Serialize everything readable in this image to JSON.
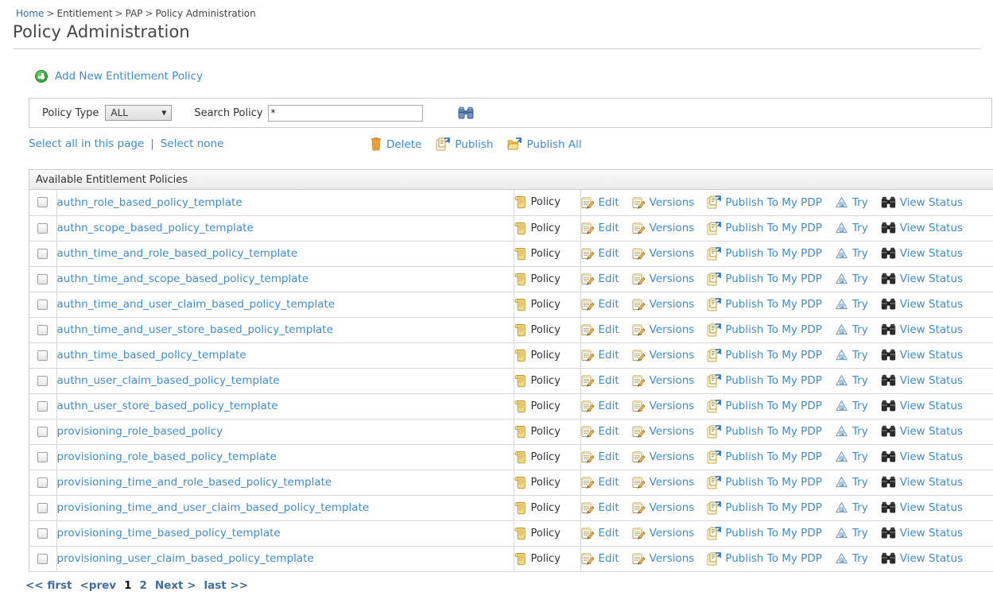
{
  "breadcrumb": {
    "items": [
      {
        "label": "Home",
        "link": true
      },
      {
        "label": "Entitlement",
        "link": false
      },
      {
        "label": "PAP",
        "link": false
      },
      {
        "label": "Policy Administration",
        "link": false
      }
    ],
    "separator": ">"
  },
  "page": {
    "title": "Policy Administration"
  },
  "actions": {
    "add_new_label": "Add New Entitlement Policy",
    "add_new_icon": "plus-circle-icon"
  },
  "filter": {
    "policy_type_label": "Policy Type",
    "policy_type_value": "ALL",
    "policy_type_options": [
      "ALL"
    ],
    "search_label": "Search Policy",
    "search_value": "*",
    "search_placeholder": "",
    "search_icon": "binoculars-icon"
  },
  "selection": {
    "select_all_label": "Select all in this page",
    "divider": "|",
    "select_none_label": "Select none"
  },
  "bulk": {
    "delete_label": "Delete",
    "delete_icon": "trash-icon",
    "publish_label": "Publish",
    "publish_icon": "publish-icon",
    "publish_all_label": "Publish All",
    "publish_all_icon": "publish-all-icon"
  },
  "table": {
    "header": "Available Entitlement Policies",
    "type_label": "Policy",
    "type_icon": "scroll-icon",
    "row_actions": [
      {
        "label": "Edit",
        "icon": "edit-note-icon"
      },
      {
        "label": "Versions",
        "icon": "versions-note-icon"
      },
      {
        "label": "Publish To My PDP",
        "icon": "publish-icon"
      },
      {
        "label": "Try",
        "icon": "try-icon"
      },
      {
        "label": "View Status",
        "icon": "binoculars-dark-icon"
      }
    ],
    "rows": [
      {
        "name": "authn_role_based_policy_template",
        "type": "Policy",
        "checked": false
      },
      {
        "name": "authn_scope_based_policy_template",
        "type": "Policy",
        "checked": false
      },
      {
        "name": "authn_time_and_role_based_policy_template",
        "type": "Policy",
        "checked": false
      },
      {
        "name": "authn_time_and_scope_based_policy_template",
        "type": "Policy",
        "checked": false
      },
      {
        "name": "authn_time_and_user_claim_based_policy_template",
        "type": "Policy",
        "checked": false
      },
      {
        "name": "authn_time_and_user_store_based_policy_template",
        "type": "Policy",
        "checked": false
      },
      {
        "name": "authn_time_based_policy_template",
        "type": "Policy",
        "checked": false
      },
      {
        "name": "authn_user_claim_based_policy_template",
        "type": "Policy",
        "checked": false
      },
      {
        "name": "authn_user_store_based_policy_template",
        "type": "Policy",
        "checked": false
      },
      {
        "name": "provisioning_role_based_policy",
        "type": "Policy",
        "checked": false
      },
      {
        "name": "provisioning_role_based_policy_template",
        "type": "Policy",
        "checked": false
      },
      {
        "name": "provisioning_time_and_role_based_policy_template",
        "type": "Policy",
        "checked": false
      },
      {
        "name": "provisioning_time_and_user_claim_based_policy_template",
        "type": "Policy",
        "checked": false
      },
      {
        "name": "provisioning_time_based_policy_template",
        "type": "Policy",
        "checked": false
      },
      {
        "name": "provisioning_user_claim_based_policy_template",
        "type": "Policy",
        "checked": false
      }
    ]
  },
  "pagination": {
    "first_label": "<< first",
    "prev_label": "<prev",
    "pages": [
      "1",
      "2"
    ],
    "current_page": "1",
    "next_label": "Next >",
    "last_label": "last >>"
  },
  "colors": {
    "link_blue": "#3f8ccc",
    "breadcrumb_blue": "#3f6e9e",
    "title_gray": "#464646",
    "border_gray": "#cbcbcb"
  }
}
